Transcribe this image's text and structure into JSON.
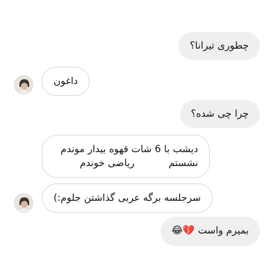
{
  "colors": {
    "outgoing_bubble": "#efefef",
    "incoming_border": "#dbdbdb",
    "background": "#ffffff"
  },
  "messages": [
    {
      "side": "outgoing",
      "text": "چطوری تیرانا؟"
    },
    {
      "side": "incoming",
      "text": "داغون",
      "avatar": "avatar-photo"
    },
    {
      "side": "outgoing",
      "text": "چرا چی شده؟"
    },
    {
      "side": "incoming",
      "lines": [
        "دیشب با 6 شات قهوه بیدار موندم",
        "نشستم           ریاضی خوندم"
      ]
    },
    {
      "side": "incoming",
      "text": "سرجلسه برگه عربی گذاشتن جلوم:)",
      "avatar": "avatar-photo"
    },
    {
      "side": "outgoing",
      "text": "بمیرم واست",
      "emojis": "😂💔"
    }
  ]
}
